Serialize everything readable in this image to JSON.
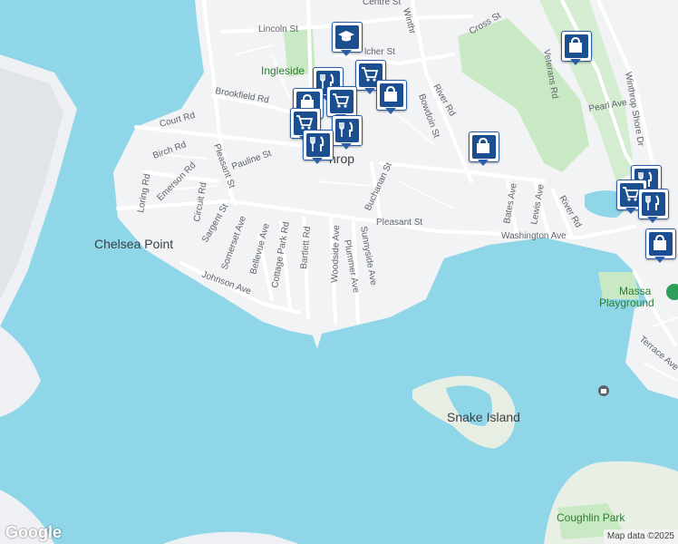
{
  "map": {
    "place_labels": {
      "winthrop": "hrop",
      "chelsea_point": "Chelsea Point",
      "snake_island": "Snake Island",
      "ingleside": "Ingleside",
      "massa": "Massa",
      "playground": "Playground",
      "coughlin_park": "Coughlin Park"
    },
    "streets": {
      "lincoln": "Lincoln St",
      "centre": "Centre St",
      "cross": "Cross St",
      "veterans": "Veterans Rd",
      "winthrop_shore": "Winthrop Shore Dr",
      "pearl": "Pearl Ave",
      "brookfield": "Brookfield Rd",
      "court": "Court Rd",
      "birch": "Birch Rd",
      "emerson": "Emerson Rd",
      "loring": "Loring Rd",
      "circuit": "Circuit Rd",
      "pauline": "Pauline St",
      "pleasant_v": "Pleasant St",
      "sargent": "Sargent St",
      "somerset": "Somerset Ave",
      "bellevue": "Bellevue Ave",
      "cottage_park": "Cottage Park Rd",
      "bartlett": "Bartlett Rd",
      "woodside": "Woodside Ave",
      "plummer": "Plummer Ave",
      "sunnyside": "Sunnyside Ave",
      "buchanan": "Buchanan St",
      "bowdoin": "Bowdoin St",
      "river_n": "River Rd",
      "pleasant_h": "Pleasant St",
      "washington": "Washington Ave",
      "bates": "Bates Ave",
      "lewis": "Lewis Ave",
      "river_s": "River Rd",
      "johnson": "Johnson Ave",
      "terrace": "Terrace Ave",
      "winthrop_st": "Winthr",
      "belcher": "lcher St"
    },
    "pins": [
      {
        "type": "school",
        "icon": "graduation-cap-icon"
      },
      {
        "type": "shopping",
        "icon": "shopping-bag-icon"
      },
      {
        "type": "shopping",
        "icon": "shopping-bag-icon"
      },
      {
        "type": "shopping",
        "icon": "shopping-bag-icon"
      },
      {
        "type": "restaurant",
        "icon": "fork-knife-icon"
      },
      {
        "type": "grocery",
        "icon": "shopping-cart-icon"
      },
      {
        "type": "restaurant",
        "icon": "fork-knife-icon"
      },
      {
        "type": "grocery",
        "icon": "shopping-cart-icon"
      },
      {
        "type": "restaurant",
        "icon": "fork-knife-icon"
      },
      {
        "type": "restaurant",
        "icon": "fork-knife-icon"
      },
      {
        "type": "shopping",
        "icon": "shopping-bag-icon"
      },
      {
        "type": "restaurant",
        "icon": "fork-knife-icon"
      },
      {
        "type": "grocery",
        "icon": "shopping-cart-icon"
      },
      {
        "type": "restaurant",
        "icon": "fork-knife-icon"
      },
      {
        "type": "shopping",
        "icon": "shopping-bag-icon"
      }
    ],
    "colors": {
      "water": "#8fd6e8",
      "land": "#f2f3f5",
      "park": "#c9e8c4",
      "road": "#ffffff",
      "pin": "#1b4f8f"
    }
  },
  "footer": {
    "logo": "Google",
    "attribution": "Map data ©2025"
  }
}
